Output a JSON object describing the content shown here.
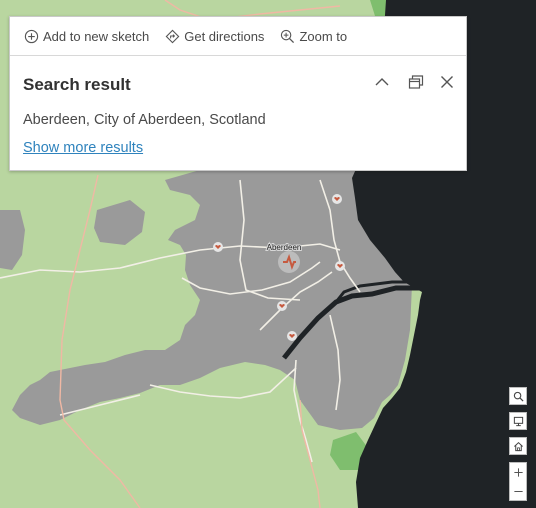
{
  "toolbar": {
    "add_sketch_label": "Add to new sketch",
    "directions_label": "Get directions",
    "zoom_to_label": "Zoom to"
  },
  "popup": {
    "title": "Search result",
    "result_text": "Aberdeen, City of Aberdeen, Scotland",
    "show_more_label": "Show more results"
  },
  "map": {
    "city_label": "Aberdeen",
    "colors": {
      "land": "#b9d6a0",
      "urban": "#9a9a9a",
      "sea": "#1f2326",
      "roads": "#f2efe6",
      "major_roads": "#f0b8a4",
      "parks": "#7fbe6e",
      "hospital": "#c65a3f"
    }
  },
  "controls": {
    "icons": [
      "search-icon",
      "screen-icon",
      "home-icon",
      "zoom-in-icon",
      "zoom-out-icon"
    ]
  }
}
